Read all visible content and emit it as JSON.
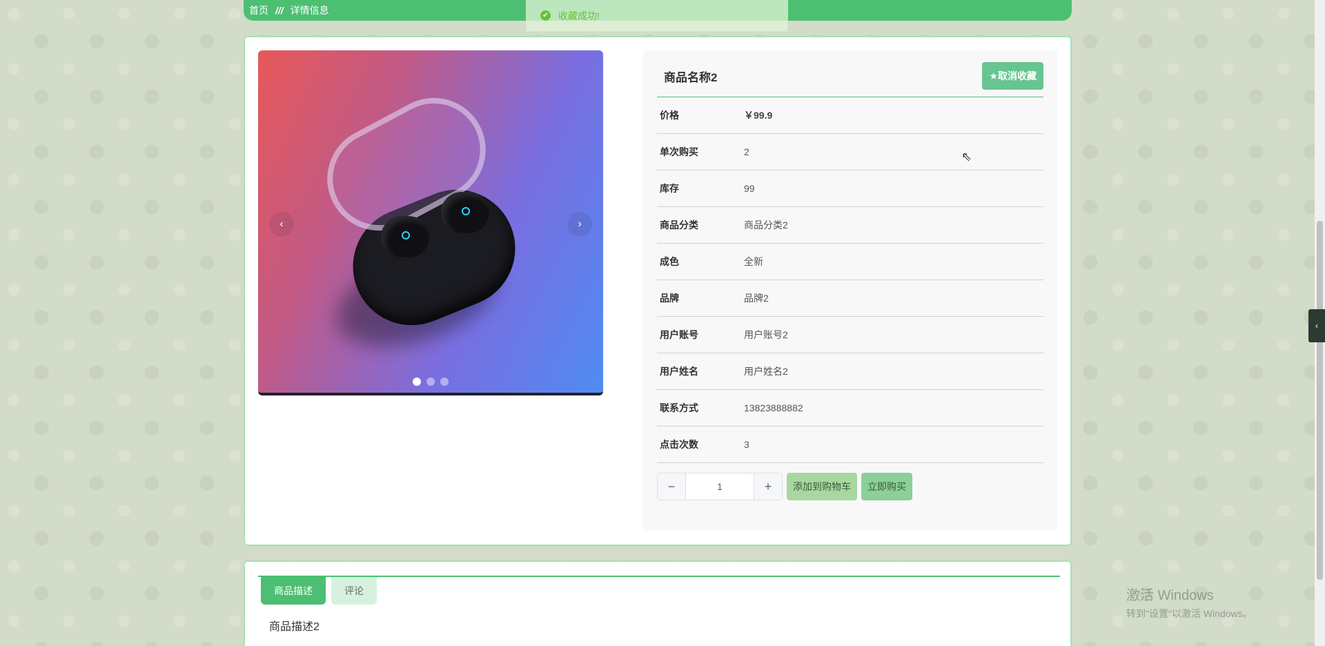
{
  "breadcrumb": {
    "home": "首页",
    "separator": "///",
    "current": "详情信息"
  },
  "toast": {
    "message": "收藏成功!",
    "icon": "check-circle-icon"
  },
  "product": {
    "title": "商品名称2",
    "favorite_button": "★取消收藏",
    "fields": [
      {
        "label": "价格",
        "value": "￥99.9"
      },
      {
        "label": "单次购买",
        "value": "2"
      },
      {
        "label": "库存",
        "value": "99"
      },
      {
        "label": "商品分类",
        "value": "商品分类2"
      },
      {
        "label": "成色",
        "value": "全新"
      },
      {
        "label": "品牌",
        "value": "品牌2"
      },
      {
        "label": "用户账号",
        "value": "用户账号2"
      },
      {
        "label": "用户姓名",
        "value": "用户姓名2"
      },
      {
        "label": "联系方式",
        "value": "13823888882"
      },
      {
        "label": "点击次数",
        "value": "3"
      }
    ]
  },
  "carousel": {
    "prev": "‹",
    "next": "›",
    "slide_count": 3,
    "active_index": 0
  },
  "purchase": {
    "minus": "−",
    "plus": "+",
    "quantity": "1",
    "add_to_cart": "添加到购物车",
    "buy_now": "立即购买"
  },
  "tabs": [
    {
      "label": "商品描述",
      "active": true
    },
    {
      "label": "评论",
      "active": false
    }
  ],
  "description": "商品描述2",
  "watermark": {
    "line1": "激活 Windows",
    "line2": "转到\"设置\"以激活 Windows。"
  },
  "side_toggle": "‹",
  "colors": {
    "primary": "#4cbf72",
    "border": "#a9dfb8",
    "success": "#67c23a"
  }
}
